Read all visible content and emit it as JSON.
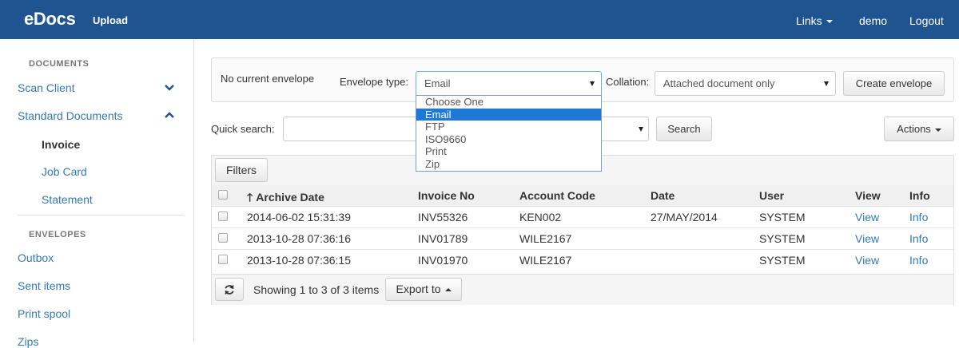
{
  "navbar": {
    "brand": "eDocs",
    "upload": "Upload",
    "links": "Links",
    "user": "demo",
    "logout": "Logout",
    "bg_color": "#1f5491"
  },
  "sidebar": {
    "documents_header": "DOCUMENTS",
    "scan_client": "Scan Client",
    "standard_documents": "Standard Documents",
    "doc_items": [
      "Invoice",
      "Job Card",
      "Statement"
    ],
    "active_item": "Invoice",
    "envelopes_header": "ENVELOPES",
    "envelope_items": [
      "Outbox",
      "Sent items",
      "Print spool",
      "Zips"
    ]
  },
  "envelope": {
    "status": "No current envelope",
    "type_label": "Envelope type:",
    "type_value": "Email",
    "type_options": [
      "Choose One",
      "Email",
      "FTP",
      "ISO9660",
      "Print",
      "Zip"
    ],
    "type_selected": "Email",
    "collation_label": "Collation:",
    "collation_value": "Attached document only",
    "create_button": "Create envelope"
  },
  "search": {
    "label": "Quick search:",
    "button": "Search",
    "actions": "Actions"
  },
  "table": {
    "filters": "Filters",
    "columns": [
      "Archive Date",
      "Invoice No",
      "Account Code",
      "Date",
      "User",
      "View",
      "Info"
    ],
    "rows": [
      [
        "2014-06-02 15:31:39",
        "INV55326",
        "KEN002",
        "27/MAY/2014",
        "SYSTEM",
        "View",
        "Info"
      ],
      [
        "2013-10-28 07:36:16",
        "INV01789",
        "WILE2167",
        "",
        "SYSTEM",
        "View",
        "Info"
      ],
      [
        "2013-10-28 07:36:15",
        "INV01970",
        "WILE2167",
        "",
        "SYSTEM",
        "View",
        "Info"
      ]
    ],
    "showing": "Showing 1 to 3 of 3 items",
    "export": "Export to"
  },
  "icons": {
    "sort": "arrow-up-icon",
    "refresh": "refresh-icon",
    "chevron_down": "chevron-down-icon",
    "chevron_up": "chevron-up-icon"
  }
}
